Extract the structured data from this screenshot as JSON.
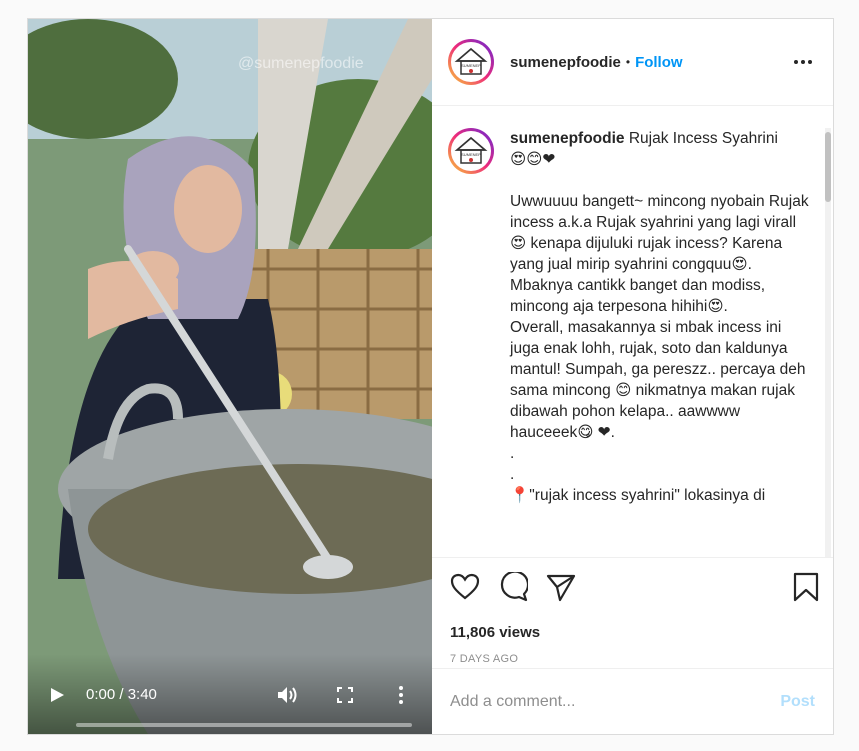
{
  "video": {
    "watermark": "@sumenepfoodie",
    "time_label": "0:00 / 3:40",
    "progress": 0
  },
  "header": {
    "username": "sumenepfoodie",
    "separator": "•",
    "follow_label": "Follow",
    "avatar_text": "SUMENEP"
  },
  "caption": {
    "username": "sumenepfoodie",
    "title": "Rujak Incess Syahrini",
    "title_emojis": "😍😊❤",
    "body": "Uwwuuuu bangett~ mincong nyobain Rujak incess a.k.a Rujak syahrini yang lagi virall😍 kenapa dijuluki rujak incess? Karena yang jual mirip syahrini congquu😍.\nMbaknya cantikk banget dan modiss, mincong aja terpesona hihihi😍.\nOverall, masakannya si mbak incess ini juga enak lohh, rujak, soto dan kaldunya mantul! Sumpah, ga pereszz.. percaya deh sama mincong 😊 nikmatnya makan rujak dibawah pohon kelapa.. aawwww hauceeek😋 ❤.\n.\n.\n📍\"rujak incess syahrini\" lokasinya di"
  },
  "stats": {
    "views": "11,806 views",
    "age": "7 DAYS AGO"
  },
  "comment_box": {
    "placeholder": "Add a comment...",
    "post_label": "Post"
  },
  "colors": {
    "accent": "#0095f6",
    "post_disabled": "#b2dffc",
    "muted": "#8e8e8e"
  }
}
